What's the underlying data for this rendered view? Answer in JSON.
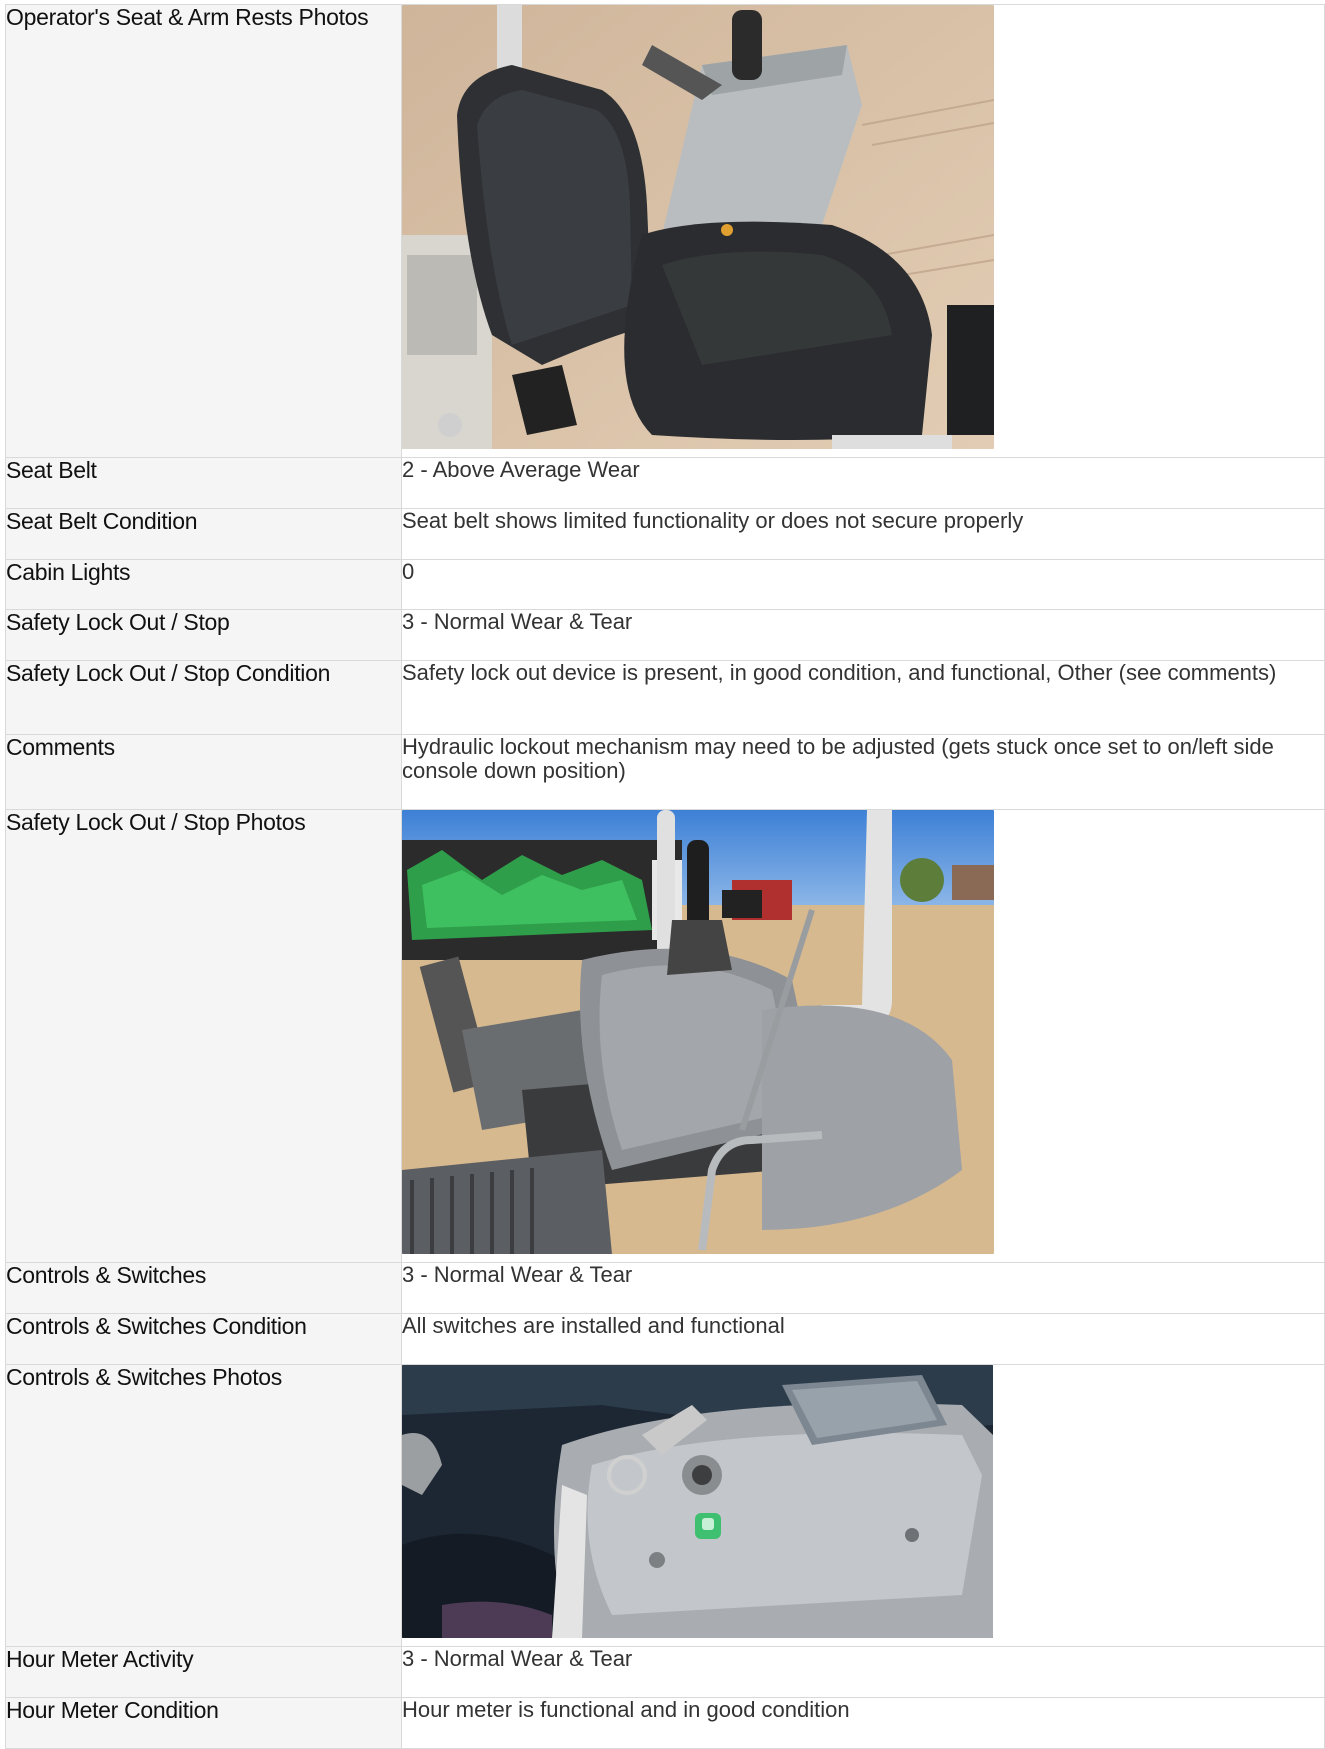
{
  "rows": [
    {
      "label": "Operator's Seat & Arm Rests Photos",
      "photo": "seat-armrest-photo"
    },
    {
      "label": "Seat Belt",
      "value": "2 - Above Average Wear"
    },
    {
      "label": "Seat Belt Condition",
      "value": "Seat belt shows limited functionality or does not secure properly"
    },
    {
      "label": "Cabin Lights",
      "value": "0"
    },
    {
      "label": "Safety Lock Out / Stop",
      "value": "3 - Normal Wear & Tear"
    },
    {
      "label": "Safety Lock Out / Stop Condition",
      "value": "Safety lock out device is present, in good condition, and functional, Other (see comments)"
    },
    {
      "label": "Comments",
      "value": "Hydraulic lockout mechanism may need to be adjusted (gets stuck once set to on/left side console down position)"
    },
    {
      "label": "Safety Lock Out / Stop Photos",
      "photo": "safety-lockout-photo"
    },
    {
      "label": "Controls & Switches",
      "value": "3 - Normal Wear & Tear"
    },
    {
      "label": "Controls & Switches Condition",
      "value": "All switches are installed and functional"
    },
    {
      "label": "Controls & Switches Photos",
      "photo": "controls-switches-photo"
    },
    {
      "label": "Hour Meter Activity",
      "value": "3 - Normal Wear & Tear"
    },
    {
      "label": "Hour Meter Condition",
      "value": "Hour meter is functional and in good condition"
    }
  ]
}
